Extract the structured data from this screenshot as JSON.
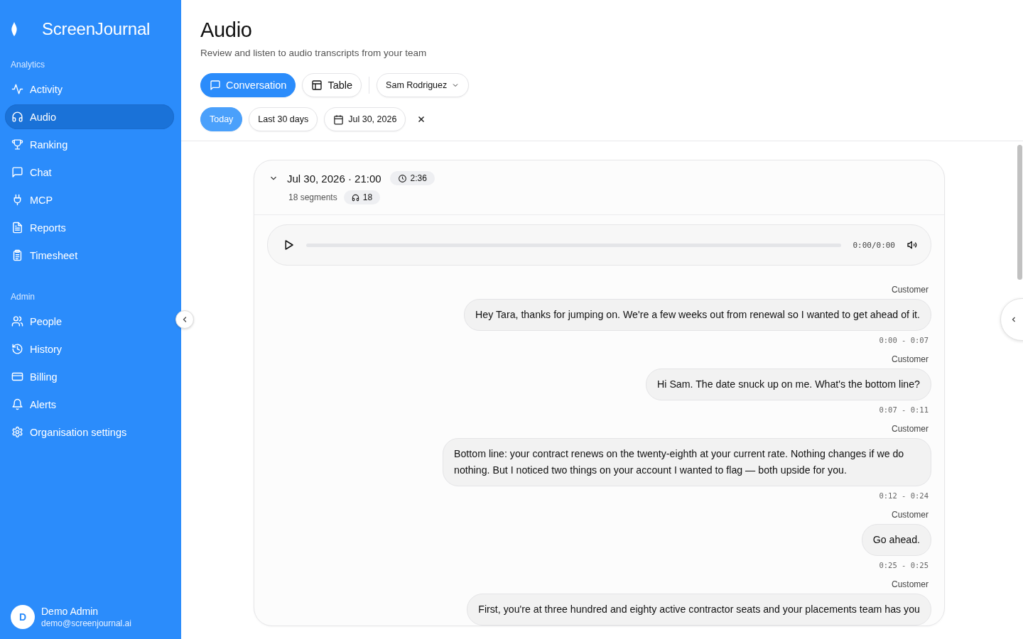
{
  "sidebar": {
    "brand": "ScreenJournal",
    "sections": [
      {
        "title": "Analytics",
        "items": [
          {
            "label": "Activity",
            "selected": false
          },
          {
            "label": "Audio",
            "selected": true
          },
          {
            "label": "Ranking",
            "selected": false
          },
          {
            "label": "Chat",
            "selected": false
          },
          {
            "label": "MCP",
            "selected": false
          },
          {
            "label": "Reports",
            "selected": false
          },
          {
            "label": "Timesheet",
            "selected": false
          }
        ]
      },
      {
        "title": "Admin",
        "items": [
          {
            "label": "People",
            "selected": false
          },
          {
            "label": "History",
            "selected": false
          },
          {
            "label": "Billing",
            "selected": false
          },
          {
            "label": "Alerts",
            "selected": false
          },
          {
            "label": "Organisation settings",
            "selected": false
          }
        ]
      }
    ],
    "user": {
      "initial": "D",
      "name": "Demo Admin",
      "email": "demo@screenjournal.ai"
    }
  },
  "header": {
    "title": "Audio",
    "subtitle": "Review and listen to audio transcripts from your team"
  },
  "view_tabs": [
    {
      "label": "Conversation",
      "selected": true
    },
    {
      "label": "Table",
      "selected": false
    }
  ],
  "person_filter": {
    "value": "Sam Rodriguez"
  },
  "date_filters": [
    {
      "label": "Today",
      "selected": true
    },
    {
      "label": "Last 30 days",
      "selected": false
    }
  ],
  "date_picker": {
    "value": "Jul 30, 2026"
  },
  "recording": {
    "expanded": true,
    "title": "Jul 30, 2026 · 21:00",
    "duration": "2:36",
    "segments": "18 segments",
    "listens": "18",
    "player": {
      "time": "0:00/0:00"
    },
    "messages": [
      {
        "speaker": "Customer",
        "text": "Hey Tara, thanks for jumping on. We're a few weeks out from renewal so I wanted to get ahead of it.",
        "time": "0:00 - 0:07"
      },
      {
        "speaker": "Customer",
        "text": "Hi Sam. The date snuck up on me. What's the bottom line?",
        "time": "0:07 - 0:11"
      },
      {
        "speaker": "Customer",
        "text": "Bottom line: your contract renews on the twenty-eighth at your current rate. Nothing changes if we do nothing. But I noticed two things on your account I wanted to flag — both upside for you.",
        "time": "0:12 - 0:24"
      },
      {
        "speaker": "Customer",
        "text": "Go ahead.",
        "time": "0:25 - 0:25"
      },
      {
        "speaker": "Customer",
        "text": "First, you're at three hundred and eighty active contractor seats and your placements team has you"
      }
    ]
  }
}
